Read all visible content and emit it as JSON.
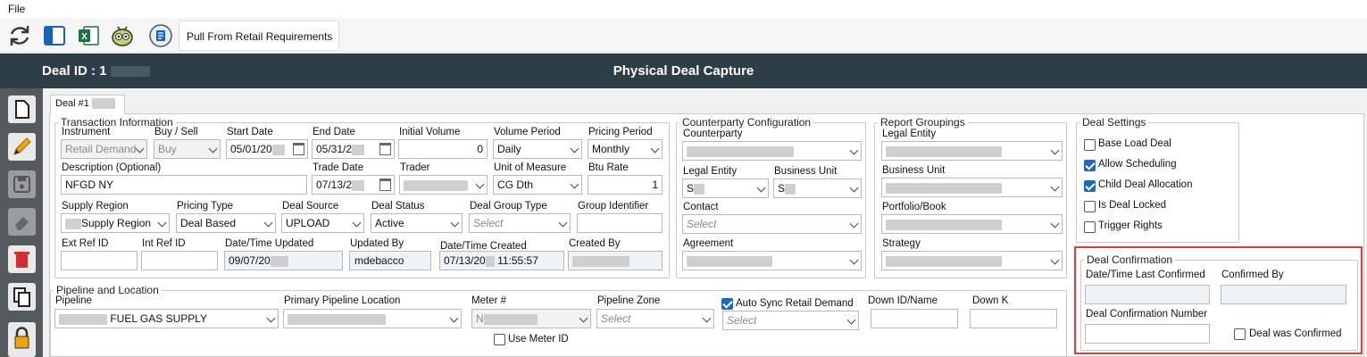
{
  "menu": {
    "file": "File"
  },
  "toolbar": {
    "pull_label": "Pull From Retail Requirements"
  },
  "header": {
    "deal_id_label": "Deal ID : 1",
    "title": "Physical Deal Capture"
  },
  "tab": {
    "label": "Deal #1"
  },
  "transaction": {
    "legend": "Transaction Information",
    "instrument_label": "Instrument",
    "instrument_value": "Retail Demand",
    "buysell_label": "Buy / Sell",
    "buysell_value": "Buy",
    "start_label": "Start Date",
    "start_value": "05/01/20",
    "end_label": "End Date",
    "end_value": "05/31/2",
    "initvol_label": "Initial Volume",
    "initvol_value": "0",
    "volperiod_label": "Volume Period",
    "volperiod_value": "Daily",
    "pricingperiod_label": "Pricing Period",
    "pricingperiod_value": "Monthly",
    "desc_label": "Description (Optional)",
    "desc_value": "NFGD NY",
    "tradedate_label": "Trade Date",
    "tradedate_value": "07/13/2",
    "trader_label": "Trader",
    "uom_label": "Unit of Measure",
    "uom_value": "CG Dth",
    "btu_label": "Btu Rate",
    "btu_value": "1",
    "supply_label": "Supply Region",
    "supply_value": "Supply Region",
    "pricingtype_label": "Pricing Type",
    "pricingtype_value": "Deal Based",
    "dealsource_label": "Deal Source",
    "dealsource_value": "UPLOAD",
    "dealstatus_label": "Deal Status",
    "dealstatus_value": "Active",
    "dealgroup_label": "Deal Group Type",
    "dealgroup_value": "Select",
    "groupid_label": "Group Identifier",
    "extref_label": "Ext Ref ID",
    "intref_label": "Int Ref ID",
    "dtupdated_label": "Date/Time Updated",
    "dtupdated_value": "09/07/20",
    "updatedby_label": "Updated By",
    "updatedby_value": "mdebacco",
    "dtcreated_label": "Date/Time Created",
    "dtcreated_value": "07/13/20",
    "dtcreated_time": "11:55:57",
    "createdby_label": "Created By"
  },
  "counterparty": {
    "legend": "Counterparty Configuration",
    "cp_label": "Counterparty",
    "legal_label": "Legal Entity",
    "legal_value": "S",
    "bu_label": "Business Unit",
    "bu_value": "S",
    "contact_label": "Contact",
    "contact_value": "Select",
    "agreement_label": "Agreement"
  },
  "reporting": {
    "legend": "Report Groupings",
    "legal_label": "Legal Entity",
    "bu_label": "Business Unit",
    "portfolio_label": "Portfolio/Book",
    "strategy_label": "Strategy"
  },
  "settings": {
    "legend": "Deal Settings",
    "items": [
      {
        "label": "Base Load Deal",
        "checked": false
      },
      {
        "label": "Allow Scheduling",
        "checked": true
      },
      {
        "label": "Child Deal Allocation",
        "checked": true
      },
      {
        "label": "Is Deal Locked",
        "checked": false
      },
      {
        "label": "Trigger Rights",
        "checked": false
      }
    ]
  },
  "confirmation": {
    "legend": "Deal Confirmation",
    "last_confirmed_label": "Date/Time Last Confirmed",
    "confirmed_by_label": "Confirmed By",
    "number_label": "Deal Confirmation Number",
    "was_confirmed_label": "Deal was Confirmed"
  },
  "pipeline": {
    "legend": "Pipeline and Location",
    "pipeline_label": "Pipeline",
    "pipeline_value": "FUEL GAS SUPPLY",
    "primary_label": "Primary Pipeline Location",
    "meter_label": "Meter #",
    "meter_value": "N",
    "zone_label": "Pipeline  Zone",
    "zone_value": "Select",
    "autosync_label": "Auto Sync Retail Demand",
    "autosync_value": "Select",
    "downid_label": "Down ID/Name",
    "downk_label": "Down K",
    "usemeter_label": "Use Meter ID"
  },
  "colors": {
    "header_bg": "#2e3e47",
    "sidebar_bg": "#555a5e",
    "highlight": "#e53935",
    "check_blue": "#1e67c5"
  }
}
